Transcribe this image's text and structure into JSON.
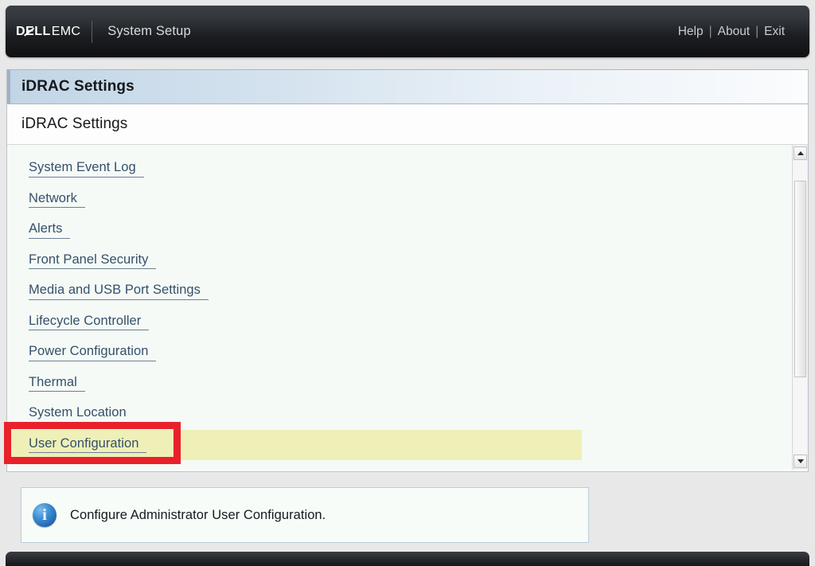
{
  "topnav": {
    "brand_dell": "DØLL",
    "brand_dell_plain": "DELL",
    "brand_emc": "EMC",
    "app_title": "System Setup",
    "links": [
      {
        "label": "Help",
        "name": "help-link"
      },
      {
        "label": "About",
        "name": "about-link"
      },
      {
        "label": "Exit",
        "name": "exit-link"
      }
    ],
    "separator": "|"
  },
  "panel": {
    "title": "iDRAC Settings",
    "subtitle": "iDRAC Settings"
  },
  "menu": {
    "items": [
      {
        "label": "System Event Log",
        "highlighted": false
      },
      {
        "label": "Network",
        "highlighted": false
      },
      {
        "label": "Alerts",
        "highlighted": false
      },
      {
        "label": "Front Panel Security",
        "highlighted": false
      },
      {
        "label": "Media and USB Port Settings",
        "highlighted": false
      },
      {
        "label": "Lifecycle Controller",
        "highlighted": false
      },
      {
        "label": "Power Configuration",
        "highlighted": false
      },
      {
        "label": "Thermal",
        "highlighted": false
      },
      {
        "label": "System Location",
        "highlighted": false
      },
      {
        "label": "User Configuration",
        "highlighted": true
      }
    ]
  },
  "scrollbar": {
    "up_arrow": "scroll-up-arrow",
    "down_arrow": "scroll-down-arrow"
  },
  "info": {
    "icon_glyph": "i",
    "text": "Configure Administrator User Configuration."
  },
  "colors": {
    "accent_blue": "#34506b",
    "highlight_yellow": "#eff0b8",
    "annotation_red": "#e8212a",
    "titlebar_blue": "#c2d5e6",
    "info_icon_blue": "#1f62ad"
  }
}
